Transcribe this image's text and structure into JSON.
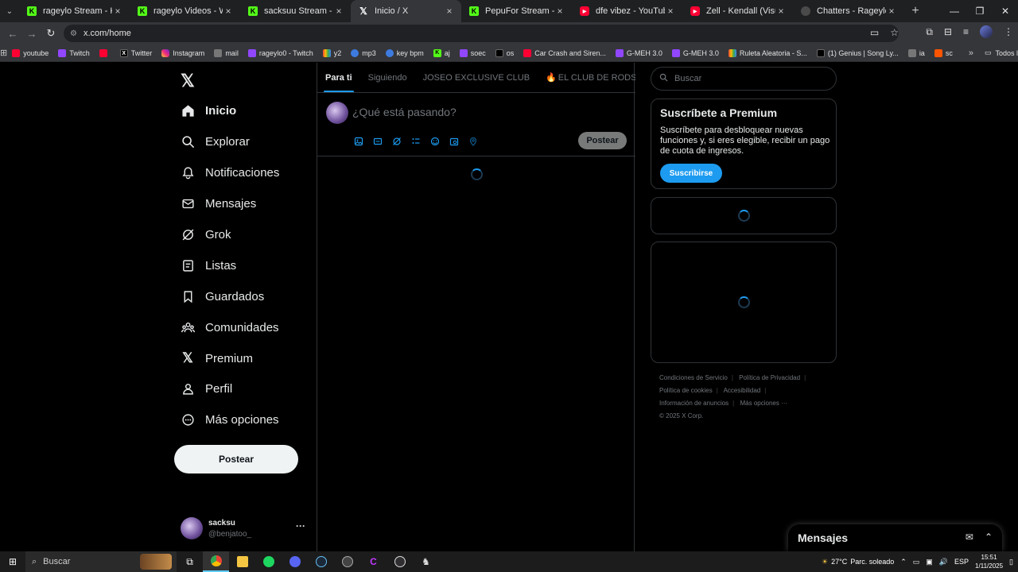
{
  "browser": {
    "tabs": [
      {
        "label": "rageylo Stream - Kick Da",
        "icon": "kick-icon",
        "active": false
      },
      {
        "label": "rageylo Videos - Watch C",
        "icon": "kick-icon",
        "active": false
      },
      {
        "label": "sacksuu Stream - Watch L",
        "icon": "kick-icon",
        "active": false
      },
      {
        "label": "Inicio / X",
        "icon": "x-icon",
        "active": true
      },
      {
        "label": "PepuFor Stream - Watch L",
        "icon": "kick-icon",
        "active": false
      },
      {
        "label": "dfe vibez - YouTube",
        "icon": "youtube-icon",
        "active": false
      },
      {
        "label": "Zell - Kendall (Visualizer)",
        "icon": "youtube-icon",
        "active": false
      },
      {
        "label": "Chatters - Rageylo",
        "icon": "cat-icon",
        "active": false
      }
    ],
    "url": "x.com/home",
    "bookmarks": [
      {
        "label": "youtube",
        "color": "red"
      },
      {
        "label": "Twitch",
        "color": "purple"
      },
      {
        "label": "",
        "color": "red"
      },
      {
        "label": "Twitter",
        "color": "black"
      },
      {
        "label": "Instagram",
        "color": "grad"
      },
      {
        "label": "mail",
        "color": "gray"
      },
      {
        "label": "rageylo0 - Twitch",
        "color": "purple"
      },
      {
        "label": "y2",
        "color": "multi"
      },
      {
        "label": "mp3",
        "color": "blue"
      },
      {
        "label": "key bpm",
        "color": "blue"
      },
      {
        "label": "aj",
        "color": "green"
      },
      {
        "label": "soec",
        "color": "purple"
      },
      {
        "label": "os",
        "color": "black"
      },
      {
        "label": "Car Crash and Siren...",
        "color": "red"
      },
      {
        "label": "G-MEH 3.0",
        "color": "purple"
      },
      {
        "label": "G-MEH 3.0",
        "color": "purple"
      },
      {
        "label": "Ruleta Aleatoria - S...",
        "color": "multi"
      },
      {
        "label": "(1) Genius | Song Ly...",
        "color": "black"
      },
      {
        "label": "ia",
        "color": "gray"
      },
      {
        "label": "sc",
        "color": "orange"
      }
    ],
    "all_bookmarks": "Todos los favoritos"
  },
  "sidebar": {
    "items": [
      {
        "label": "Inicio",
        "icon": "home-icon"
      },
      {
        "label": "Explorar",
        "icon": "search-icon"
      },
      {
        "label": "Notificaciones",
        "icon": "bell-icon"
      },
      {
        "label": "Mensajes",
        "icon": "mail-icon"
      },
      {
        "label": "Grok",
        "icon": "grok-icon"
      },
      {
        "label": "Listas",
        "icon": "list-icon"
      },
      {
        "label": "Guardados",
        "icon": "bookmark-icon"
      },
      {
        "label": "Comunidades",
        "icon": "communities-icon"
      },
      {
        "label": "Premium",
        "icon": "x-icon"
      },
      {
        "label": "Perfil",
        "icon": "profile-icon"
      },
      {
        "label": "Más opciones",
        "icon": "more-icon"
      }
    ],
    "post_button": "Postear",
    "user": {
      "name": "sacksu",
      "handle": "@benjatoo_"
    }
  },
  "main": {
    "tabs": [
      "Para ti",
      "Siguiendo",
      "JOSEO EXCLUSIVE CLUB",
      "EL CLUB DE RODSQUARE"
    ],
    "composer_placeholder": "¿Qué está pasando?",
    "composer_post": "Postear"
  },
  "right": {
    "search_placeholder": "Buscar",
    "premium": {
      "title": "Suscríbete a Premium",
      "text": "Suscríbete para desbloquear nuevas funciones y, si eres elegible, recibir un pago de cuota de ingresos.",
      "button": "Suscribirse"
    },
    "footer": {
      "terms": "Condiciones de Servicio",
      "privacy": "Política de Privacidad",
      "cookies": "Política de cookies",
      "accessibility": "Accesibilidad",
      "ads": "Información de anuncios",
      "more": "Más opciones ···",
      "copyright": "© 2025 X Corp."
    }
  },
  "messages_dock": {
    "title": "Mensajes"
  },
  "taskbar": {
    "search": "Buscar",
    "weather": "27°C",
    "weather_text": "Parc. soleado",
    "lang": "ESP",
    "time": "15:51",
    "date": "1/11/2025"
  }
}
